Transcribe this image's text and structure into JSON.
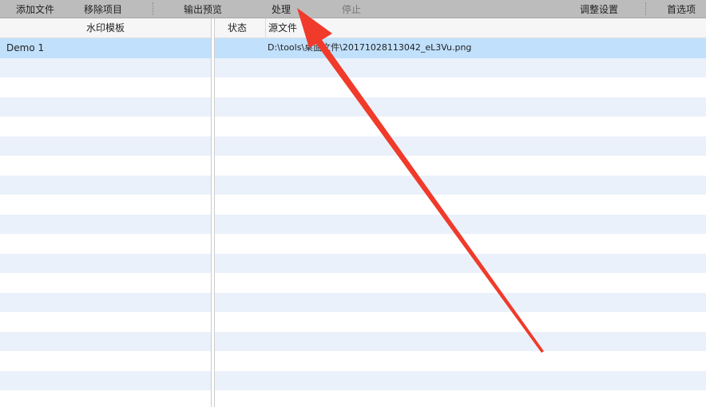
{
  "toolbar": {
    "add_file": "添加文件",
    "remove_item": "移除项目",
    "output_preview": "输出预览",
    "process": "处理",
    "stop": "停止",
    "adjust_settings": "调整设置",
    "preferences": "首选项"
  },
  "left": {
    "header": "水印模板",
    "rows": [
      "Demo 1"
    ]
  },
  "right": {
    "headers": {
      "status": "状态",
      "source": "源文件"
    },
    "rows": [
      {
        "status": "",
        "source": "D:\\tools\\桌面文件\\20171028113042_eL3Vu.png"
      }
    ]
  },
  "colors": {
    "selected": "#c1e0fc",
    "arrow": "#f03a2a"
  }
}
